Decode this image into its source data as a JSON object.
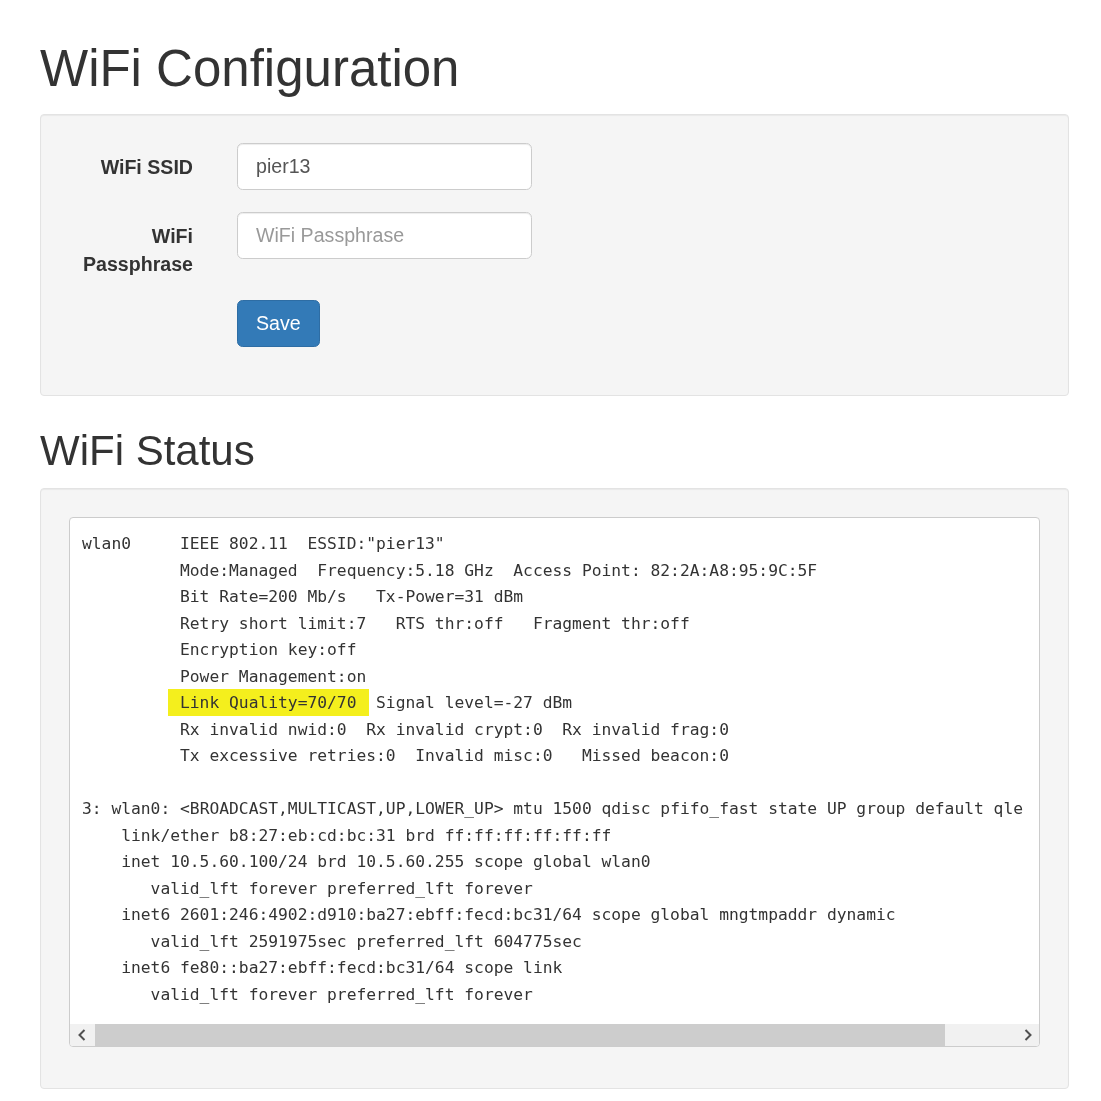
{
  "configuration": {
    "title": "WiFi Configuration",
    "fields": [
      {
        "label": "WiFi SSID",
        "value": "pier13"
      },
      {
        "label": "WiFi Passphrase",
        "placeholder": "WiFi Passphrase"
      }
    ],
    "save_button": "Save"
  },
  "status": {
    "title": "WiFi Status",
    "iwconfig": {
      "interface": "wlan0",
      "lines": [
        {
          "segments": [
            {
              "text": "IEEE 802.11  ESSID:\"pier13\"",
              "highlighted": false
            }
          ]
        },
        {
          "segments": [
            {
              "text": "Mode:Managed  Frequency:5.18 GHz  Access Point: 82:2A:A8:95:9C:5F",
              "highlighted": false
            }
          ]
        },
        {
          "segments": [
            {
              "text": "Bit Rate=200 Mb/s   Tx-Power=31 dBm",
              "highlighted": false
            }
          ]
        },
        {
          "segments": [
            {
              "text": "Retry short limit:7   RTS thr:off   Fragment thr:off",
              "highlighted": false
            }
          ]
        },
        {
          "segments": [
            {
              "text": "Encryption key:off",
              "highlighted": false
            }
          ]
        },
        {
          "segments": [
            {
              "text": "Power Management:on",
              "highlighted": false
            }
          ]
        },
        {
          "segments": [
            {
              "text": "Link Quality=70/70",
              "highlighted": true
            },
            {
              "text": "Signal level=-27 dBm",
              "highlighted": false
            }
          ]
        },
        {
          "segments": [
            {
              "text": "Rx invalid nwid:0  Rx invalid crypt:0  Rx invalid frag:0",
              "highlighted": false
            }
          ]
        },
        {
          "segments": [
            {
              "text": "Tx excessive retries:0  Invalid misc:0   Missed beacon:0",
              "highlighted": false
            }
          ]
        }
      ]
    },
    "ip_addr": [
      {
        "text": "3: wlan0: <BROADCAST,MULTICAST,UP,LOWER_UP> mtu 1500 qdisc pfifo_fast state UP group default qle",
        "children": [
          {
            "text": "link/ether b8:27:eb:cd:bc:31 brd ff:ff:ff:ff:ff:ff"
          },
          {
            "text": "inet 10.5.60.100/24 brd 10.5.60.255 scope global wlan0",
            "children": [
              {
                "text": "valid_lft forever preferred_lft forever"
              }
            ]
          },
          {
            "text": "inet6 2601:246:4902:d910:ba27:ebff:fecd:bc31/64 scope global mngtmpaddr dynamic",
            "children": [
              {
                "text": "valid_lft 2591975sec preferred_lft 604775sec"
              }
            ]
          },
          {
            "text": "inet6 fe80::ba27:ebff:fecd:bc31/64 scope link",
            "children": [
              {
                "text": "valid_lft forever preferred_lft forever"
              }
            ]
          }
        ]
      }
    ]
  }
}
